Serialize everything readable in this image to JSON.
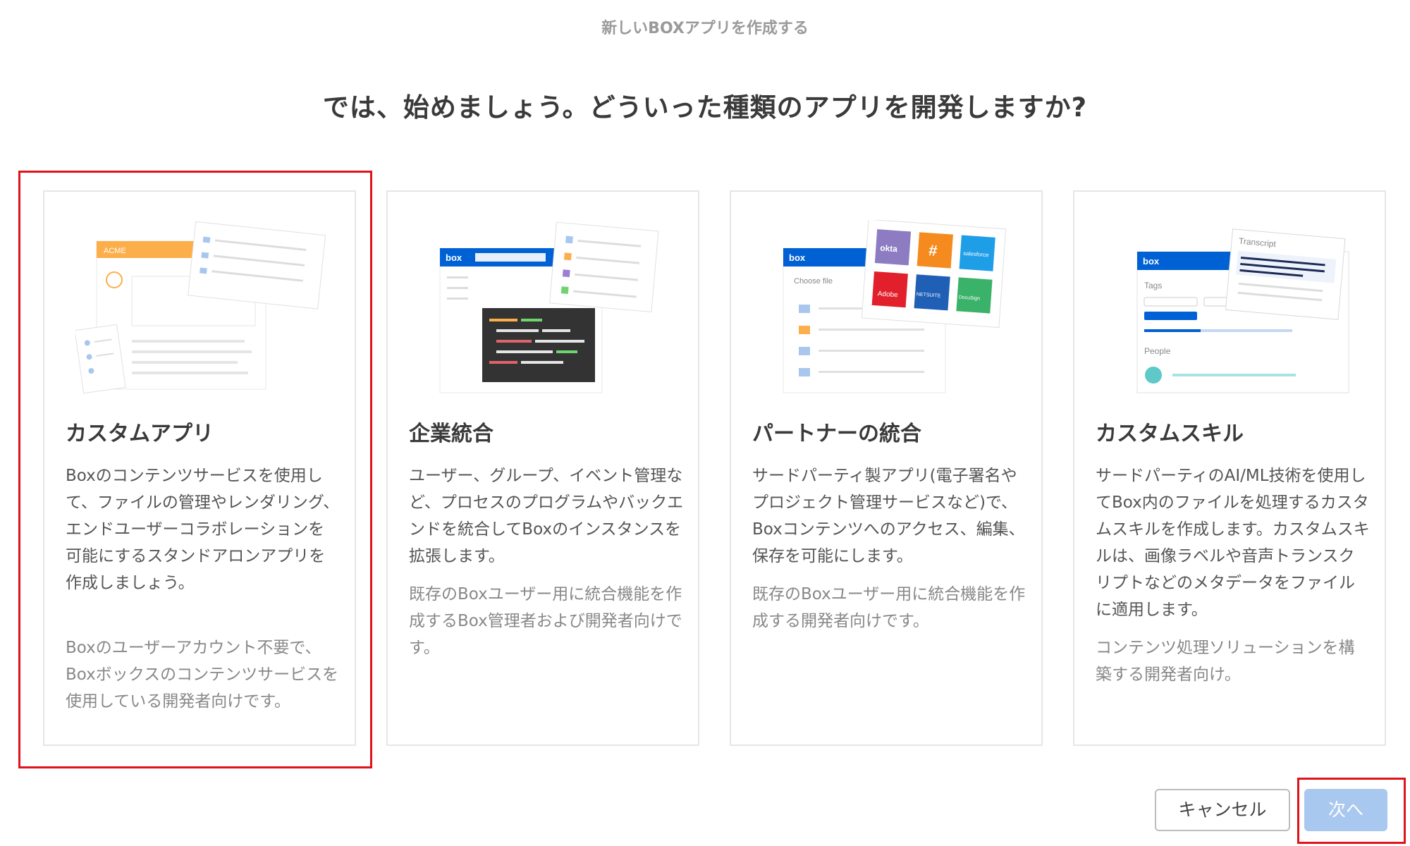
{
  "modal": {
    "title": "新しいBOXアプリを作成する"
  },
  "heading": "では、始めましょう。どういった種類のアプリを開発しますか?",
  "cards": [
    {
      "title": "カスタムアプリ",
      "description": "Boxのコンテンツサービスを使用して、ファイルの管理やレンダリング、エンドユーザーコラボレーションを可能にするスタンドアロンアプリを作成しましょう。",
      "note": "Boxのユーザーアカウント不要で、Boxボックスのコンテンツサービスを使用している開発者向けです。",
      "illustration": {
        "brand": "ACME"
      },
      "selected": true
    },
    {
      "title": "企業統合",
      "description": "ユーザー、グループ、イベント管理など、プロセスのプログラムやバックエンドを統合してBoxのインスタンスを拡張します。",
      "note": "既存のBoxユーザー用に統合機能を作成するBox管理者および開発者向けです。",
      "illustration": {
        "brand": "box"
      }
    },
    {
      "title": "パートナーの統合",
      "description": "サードパーティ製アプリ(電子署名やプロジェクト管理サービスなど)で、Boxコンテンツへのアクセス、編集、保存を可能にします。",
      "note": "既存のBoxユーザー用に統合機能を作成する開発者向けです。",
      "illustration": {
        "brand": "box",
        "label": "Choose file",
        "partners": [
          "okta",
          "#",
          "salesforce",
          "Adobe",
          "NETSUITE",
          "DocuSign"
        ]
      }
    },
    {
      "title": "カスタムスキル",
      "description": "サードパーティのAI/ML技術を使用してBox内のファイルを処理するカスタムスキルを作成します。カスタムスキルは、画像ラベルや音声トランスクリプトなどのメタデータをファイルに適用します。",
      "note": "コンテンツ処理ソリューションを構築する開発者向け。",
      "illustration": {
        "brand": "box",
        "tags_label": "Tags",
        "people_label": "People",
        "transcript_label": "Transcript"
      }
    }
  ],
  "buttons": {
    "cancel": "キャンセル",
    "next": "次へ"
  },
  "colors": {
    "highlight": "#e0131b",
    "next_button": "#a8c8ef",
    "box_blue": "#0061d5",
    "acme_orange": "#fcae4a"
  }
}
